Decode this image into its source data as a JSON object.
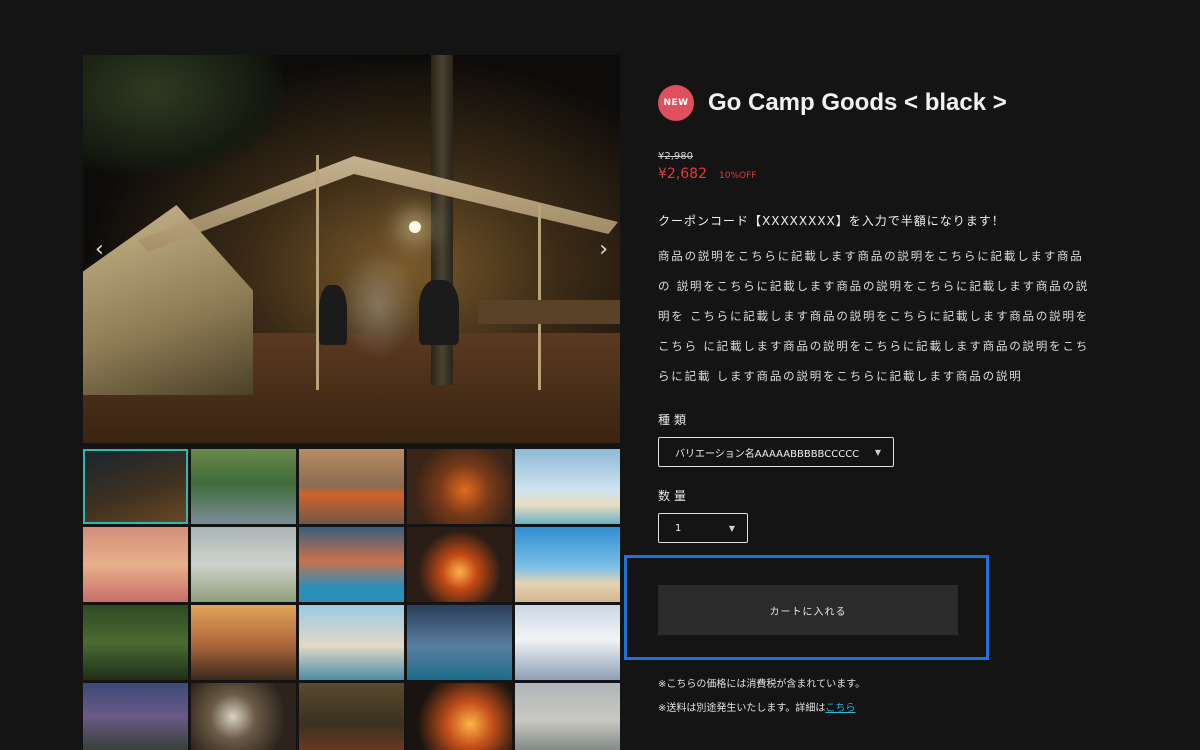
{
  "gallery": {
    "prev_arrow": "‹",
    "next_arrow": "›",
    "main_image": "Camping at night with tent, tarp, lantern and people sitting by a fire",
    "thumbnails": [
      {
        "name": "thumb-camp-night",
        "bg": "linear-gradient(160deg,#1a2430 0%,#3e3120 55%,#6b4a24 100%)",
        "active": true
      },
      {
        "name": "thumb-lakeside-tents",
        "bg": "linear-gradient(180deg,#6c8a4c 0%,#3f6b3a 45%,#7c8d96 100%)",
        "active": false
      },
      {
        "name": "thumb-orange-van",
        "bg": "linear-gradient(180deg,#b98c64 0%,#8a6c50 50%,#d1622a 60%,#6f5a48 100%)",
        "active": false
      },
      {
        "name": "thumb-orange-cup",
        "bg": "radial-gradient(circle at 55% 55%,#e26a1e 0%,#7a3a18 35%,#3a2618 70%)",
        "active": false
      },
      {
        "name": "thumb-palm-beach",
        "bg": "linear-gradient(180deg,#8fb9d6 0%,#cfe3ef 55%,#e9dcc0 75%,#6bb0c4 100%)",
        "active": false
      },
      {
        "name": "thumb-sunset-pier",
        "bg": "linear-gradient(180deg,#d38d7a 0%,#e7b08a 50%,#c86d6a 100%)",
        "active": false
      },
      {
        "name": "thumb-beach-swing",
        "bg": "linear-gradient(180deg,#a9b4b4 0%,#cfd2cc 50%,#8d9f7a 100%)",
        "active": false
      },
      {
        "name": "thumb-resort-pool",
        "bg": "linear-gradient(180deg,#3b5e7f 0%,#c9714c 45%,#2c8fb8 80%)",
        "active": false
      },
      {
        "name": "thumb-campfire",
        "bg": "radial-gradient(circle at 50% 60%,#ffb24a 0%,#c44a16 25%,#2a1d16 60%)",
        "active": false
      },
      {
        "name": "thumb-beach-umbrella",
        "bg": "linear-gradient(180deg,#2f8ed1 0%,#7fc1e8 55%,#e5d3b2 75%,#d0b790 100%)",
        "active": false
      },
      {
        "name": "thumb-jungle-laundry",
        "bg": "linear-gradient(180deg,#2f4a24 0%,#4b6b33 50%,#1f2f18 100%)",
        "active": false
      },
      {
        "name": "thumb-sunset-deck",
        "bg": "linear-gradient(180deg,#e0a45a 0%,#b26a3c 50%,#3a2a1e 100%)",
        "active": false
      },
      {
        "name": "thumb-beach-books",
        "bg": "linear-gradient(180deg,#9cc9e4 0%,#e2d8c6 55%,#4c8ba6 100%)",
        "active": false
      },
      {
        "name": "thumb-water-villa",
        "bg": "linear-gradient(180deg,#2a3f5c 0%,#5a7ea0 55%,#1d6c8a 100%)",
        "active": false
      },
      {
        "name": "thumb-snow-mountains",
        "bg": "linear-gradient(180deg,#c9d6e3 0%,#f2f4f6 45%,#8ea0b4 100%)",
        "active": false
      },
      {
        "name": "thumb-dusk-tent",
        "bg": "linear-gradient(180deg,#3c4a78 0%,#6a5a86 45%,#2d3a24 100%)",
        "active": false
      },
      {
        "name": "thumb-coffee-gear",
        "bg": "radial-gradient(circle at 40% 45%,#d9d2c4 0%,#6b5a46 30%,#2c241c 70%)",
        "active": false
      },
      {
        "name": "thumb-forest-grill",
        "bg": "linear-gradient(180deg,#5a4a2e 0%,#3a3220 55%,#7a3a22 100%)",
        "active": false
      },
      {
        "name": "thumb-marshmallow-fire",
        "bg": "radial-gradient(circle at 60% 55%,#ffb347 0%,#c4501a 30%,#1a1410 70%)",
        "active": false
      },
      {
        "name": "thumb-family-beach",
        "bg": "linear-gradient(180deg,#aeb6ba 0%,#c9c8c0 50%,#6f7a78 100%)",
        "active": false
      }
    ]
  },
  "product": {
    "badge": "NEW",
    "title": "Go Camp Goods < black >",
    "price_original": "¥2,980",
    "price_sale": "¥2,682",
    "discount": "10%OFF",
    "coupon": "クーポンコード【XXXXXXXX】を入力で半額になります！",
    "description_lines": [
      "商品の説明をこちらに記載します商品の説明をこちらに記載します商品",
      "の 説明をこちらに記載します商品の説明をこちらに記載します商品の説",
      "明を こちらに記載します商品の説明をこちらに記載します商品の説明を",
      "こちら に記載します商品の説明をこちらに記載します商品の説明をこち",
      "らに記載 します商品の説明をこちらに記載します商品の説明"
    ],
    "variant_label": "種類",
    "variant_value": "バリエーション名AAAAABBBBBCCCCC",
    "quantity_label": "数量",
    "quantity_value": "1",
    "caret": "▼",
    "cart_button": "カートに入れる",
    "note_tax": "※こちらの価格には消費税が含まれています。",
    "note_shipping": "※送料は別途発生いたします。詳細は",
    "note_link": "こちら"
  },
  "colors": {
    "background": "#141414",
    "badge": "#e0505c",
    "sale_price": "#e13a3a",
    "highlight": "#1e72d9",
    "link": "#2fb8d8",
    "thumb_active": "#2fb8b0"
  }
}
